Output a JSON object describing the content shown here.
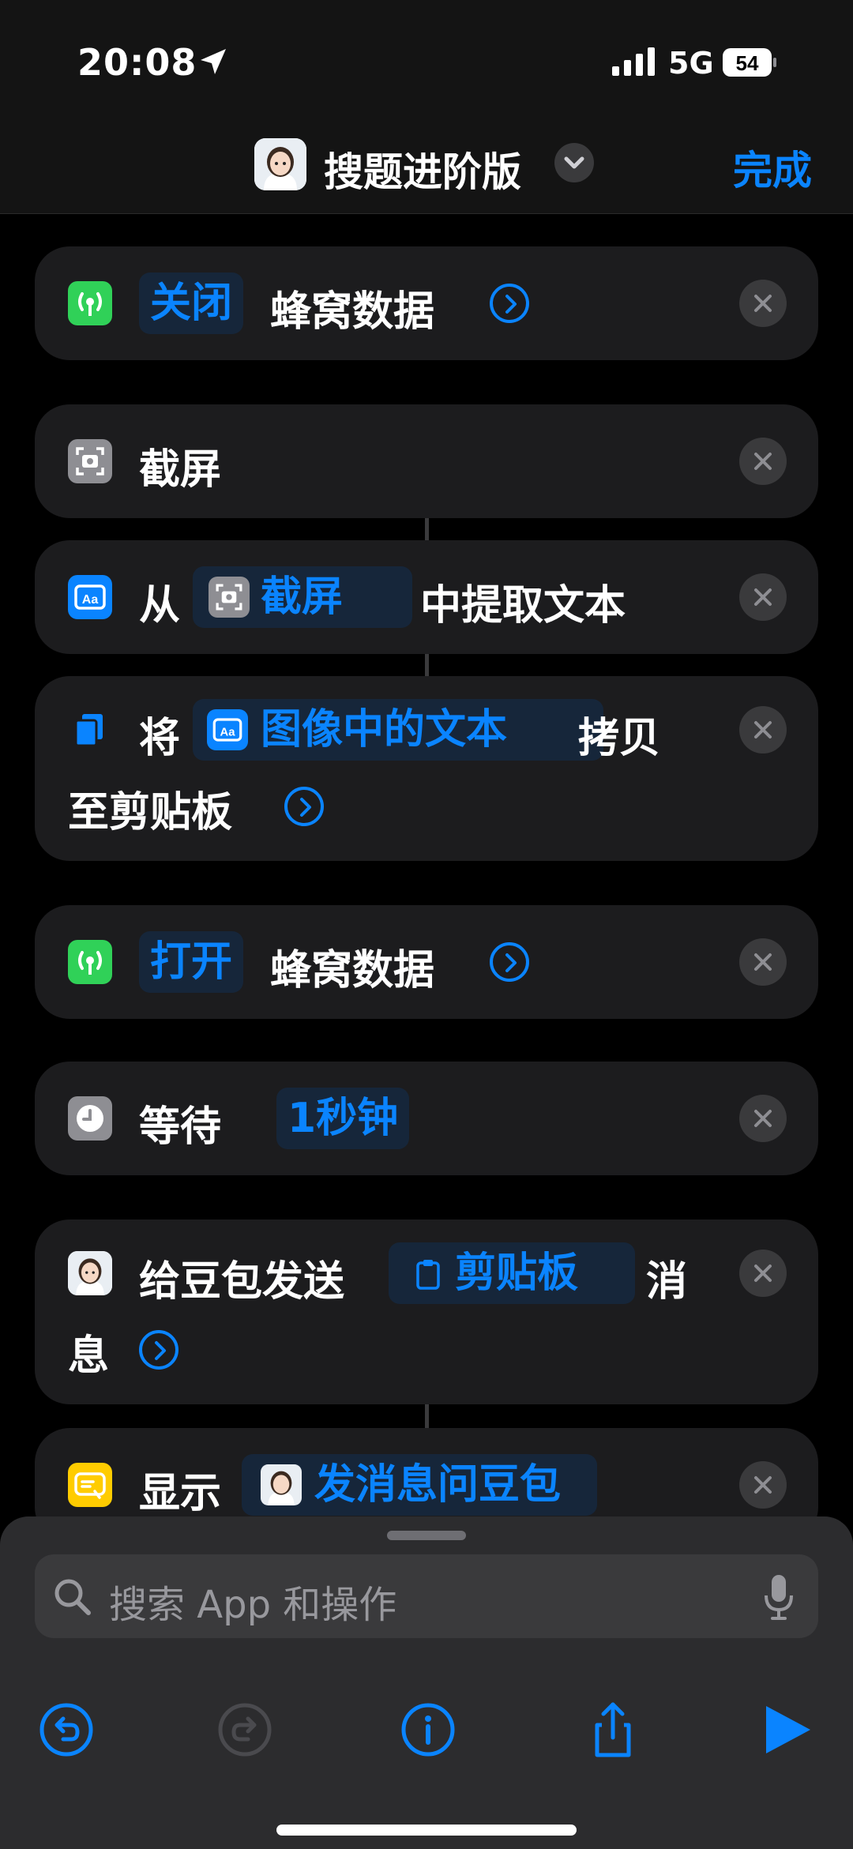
{
  "status": {
    "time": "20:08",
    "network": "5G",
    "battery": "54"
  },
  "nav": {
    "title": "搜题进阶版",
    "done": "完成"
  },
  "actions": [
    {
      "verb": "关闭",
      "object": "蜂窝数据"
    },
    {
      "label": "截屏"
    },
    {
      "prefix": "从",
      "token": "截屏",
      "suffix": "中提取文本"
    },
    {
      "prefix": "将",
      "token": "图像中的文本",
      "suffix": "拷贝",
      "line2": "至剪贴板"
    },
    {
      "verb": "打开",
      "object": "蜂窝数据"
    },
    {
      "prefix": "等待",
      "token": "1秒钟"
    },
    {
      "prefix": "给豆包发送",
      "token": "剪贴板",
      "suffix": "消",
      "line2": "息"
    },
    {
      "prefix": "显示",
      "token": "发消息问豆包"
    }
  ],
  "search": {
    "placeholder": "搜索 App 和操作"
  },
  "icons": {
    "cellular": "cellular-antenna-icon",
    "screenshot": "screenshot-icon",
    "text": "extract-text-icon",
    "copy": "document-copy-icon",
    "clock": "clock-icon",
    "clipboard": "clipboard-icon",
    "show": "show-result-icon"
  },
  "colors": {
    "accent": "#0a84ff",
    "green": "#30d158",
    "yellow": "#ffcc00",
    "card": "#1c1c1e"
  }
}
